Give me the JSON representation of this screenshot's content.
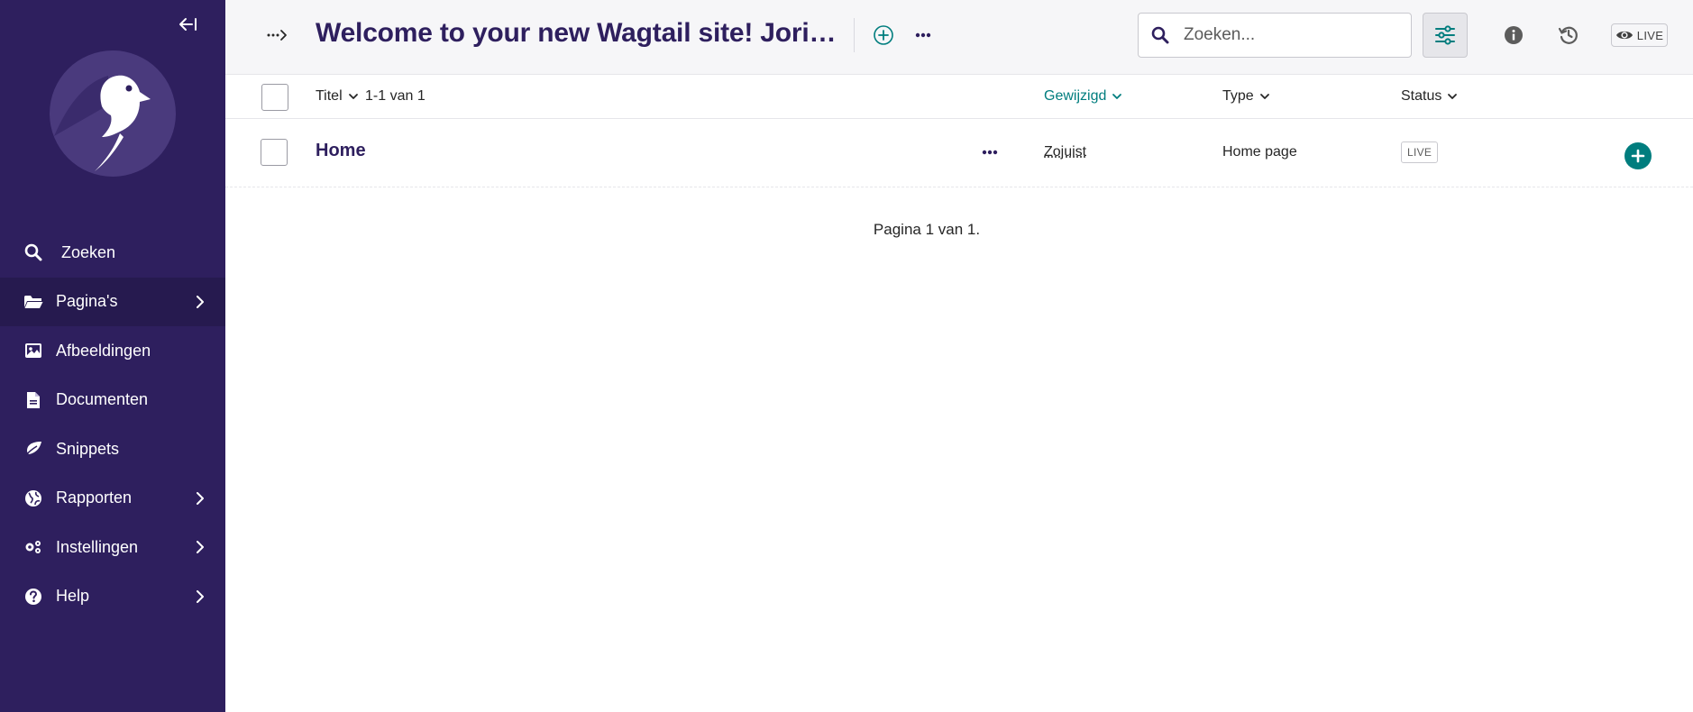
{
  "sidebar": {
    "items": [
      {
        "label": "Zoeken",
        "icon": "search-icon",
        "has_submenu": false
      },
      {
        "label": "Pagina's",
        "icon": "folder-open-icon",
        "has_submenu": true,
        "active": true
      },
      {
        "label": "Afbeeldingen",
        "icon": "image-icon",
        "has_submenu": false
      },
      {
        "label": "Documenten",
        "icon": "document-icon",
        "has_submenu": false
      },
      {
        "label": "Snippets",
        "icon": "leaf-icon",
        "has_submenu": false
      },
      {
        "label": "Rapporten",
        "icon": "globe-icon",
        "has_submenu": true
      },
      {
        "label": "Instellingen",
        "icon": "cogs-icon",
        "has_submenu": true
      },
      {
        "label": "Help",
        "icon": "help-icon",
        "has_submenu": true
      }
    ]
  },
  "header": {
    "title": "Welcome to your new Wagtail site! Joris...",
    "search_placeholder": "Zoeken...",
    "live_label": "LIVE"
  },
  "table": {
    "columns": {
      "title": "Titel",
      "count": "1-1 van 1",
      "updated": "Gewijzigd",
      "type": "Type",
      "status": "Status"
    },
    "rows": [
      {
        "title": "Home",
        "updated": "Zojuist",
        "type": "Home page",
        "status": "LIVE"
      }
    ]
  },
  "pagination": "Pagina 1 van 1.",
  "colors": {
    "sidebar_bg": "#2e1f5e",
    "accent_teal": "#007d7e",
    "title_color": "#2e1f5e"
  }
}
